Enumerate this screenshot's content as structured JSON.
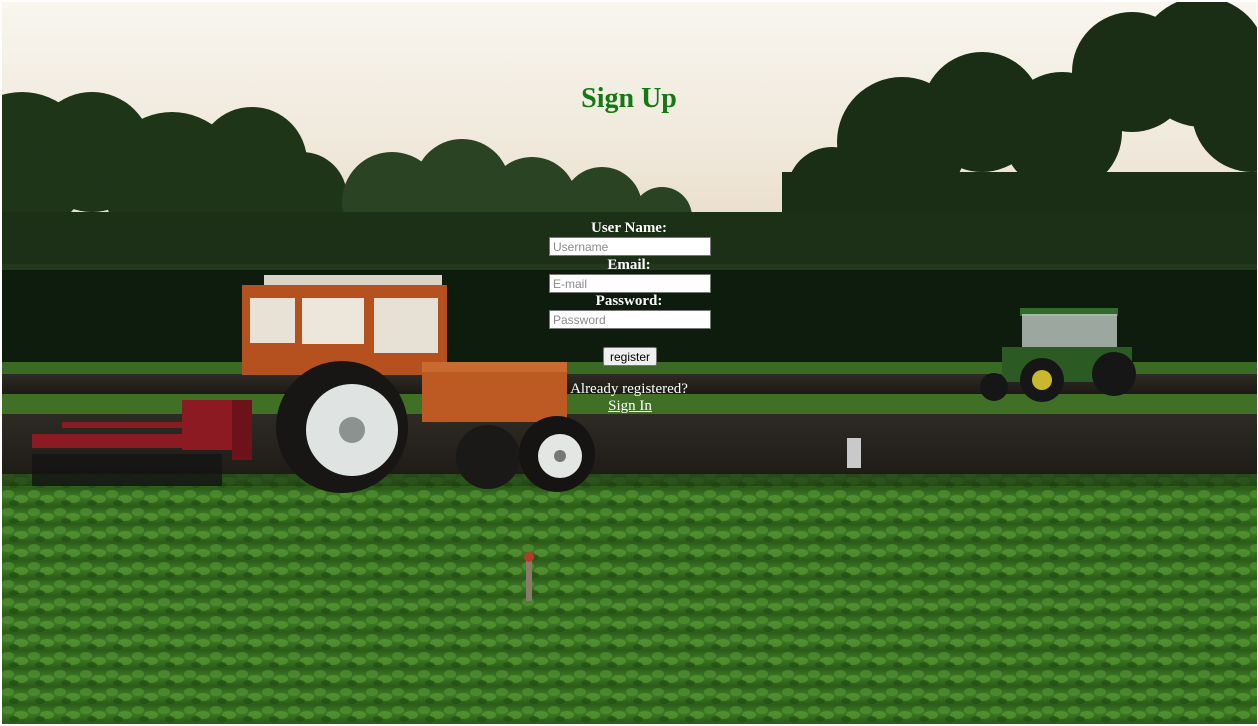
{
  "title": "Sign Up",
  "colors": {
    "title": "#137a13",
    "label": "#ffffff",
    "button_bg": "#efefef"
  },
  "form": {
    "username_label": "User Name:",
    "username_placeholder": "Username",
    "email_label": "Email:",
    "email_placeholder": "E-mail",
    "password_label": "Password:",
    "password_placeholder": "Password",
    "register_label": "register"
  },
  "footer": {
    "already_text": "Already registered?",
    "signin_label": "Sign In"
  }
}
